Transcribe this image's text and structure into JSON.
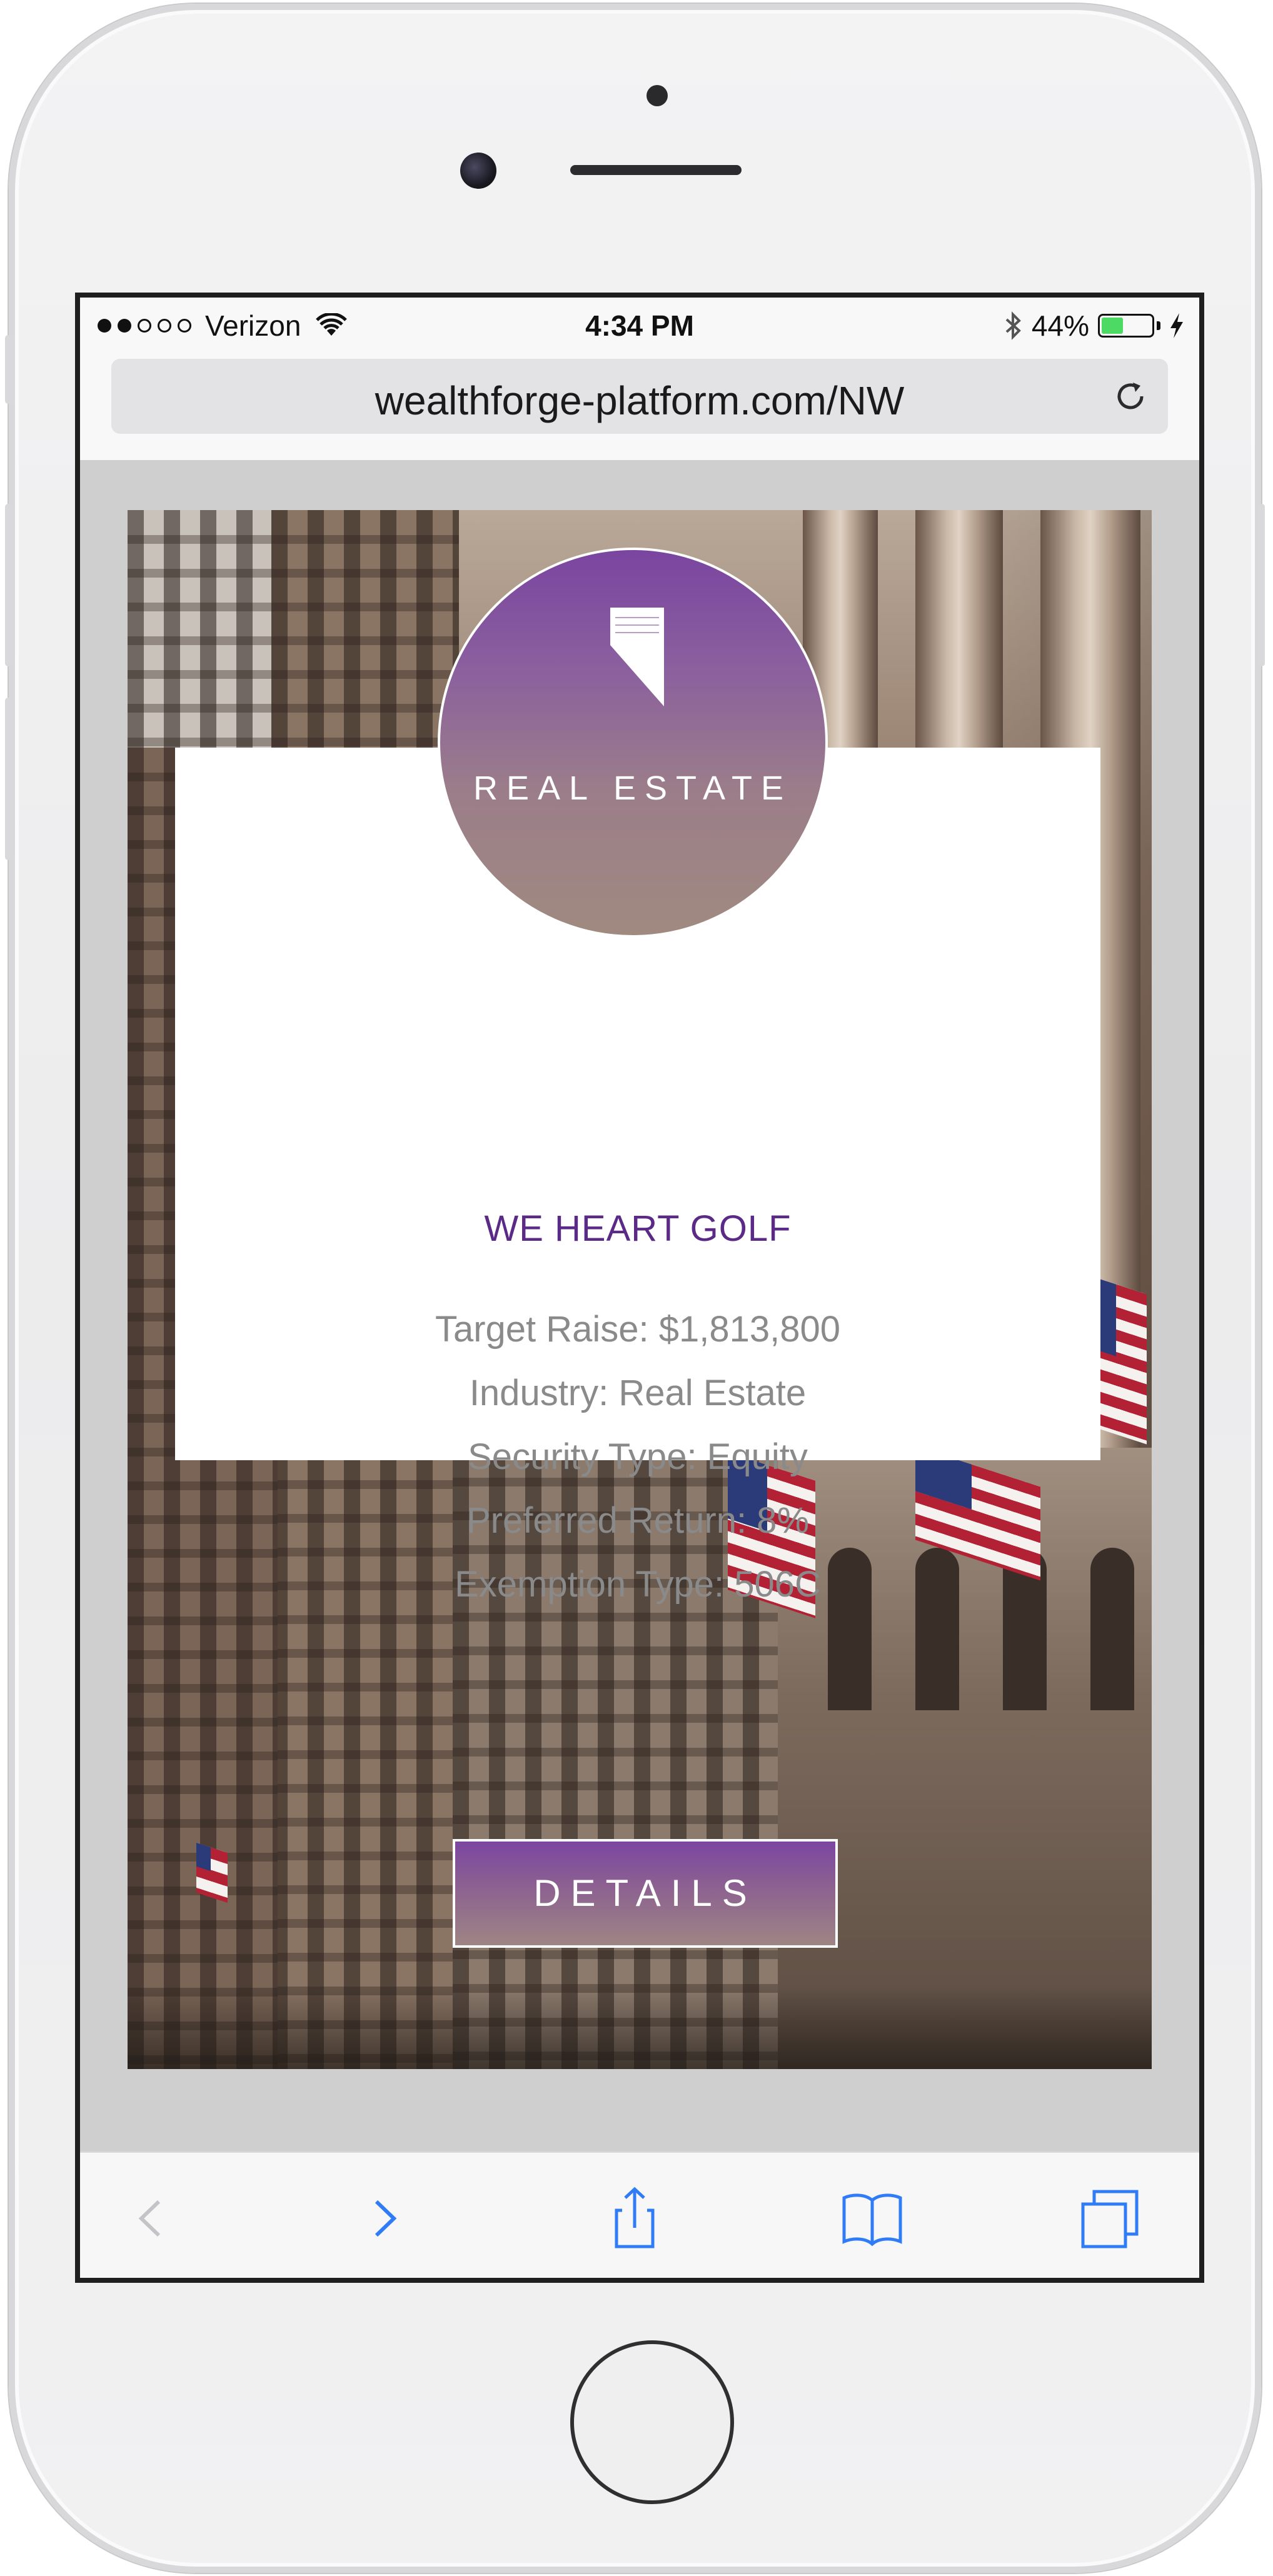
{
  "status_bar": {
    "carrier": "Verizon",
    "time": "4:34 PM",
    "battery_percent": "44%",
    "battery_level": 0.44,
    "signal_bars_full": 2,
    "signal_bars_total": 5
  },
  "browser": {
    "url": "wealthforge-platform.com/NW"
  },
  "offering": {
    "category": "REAL ESTATE",
    "title": "WE HEART GOLF",
    "details": [
      "Target Raise: $1,813,800",
      "Industry: Real Estate",
      "Security Type: Equity",
      "Preferred Return: 8%",
      "Exemption Type: 506C"
    ],
    "button_label": "DETAILS"
  },
  "colors": {
    "accent_purple": "#5b2a86",
    "badge_gradient_top": "#7a45a0",
    "badge_gradient_bottom": "#a08a80",
    "ios_blue": "#2f7cf6",
    "battery_green": "#4cd964"
  },
  "icons": {
    "reload": "reload-icon",
    "back": "chevron-left-icon",
    "forward": "chevron-right-icon",
    "share": "share-icon",
    "bookmarks": "book-icon",
    "tabs": "tabs-icon",
    "category": "building-icon"
  }
}
